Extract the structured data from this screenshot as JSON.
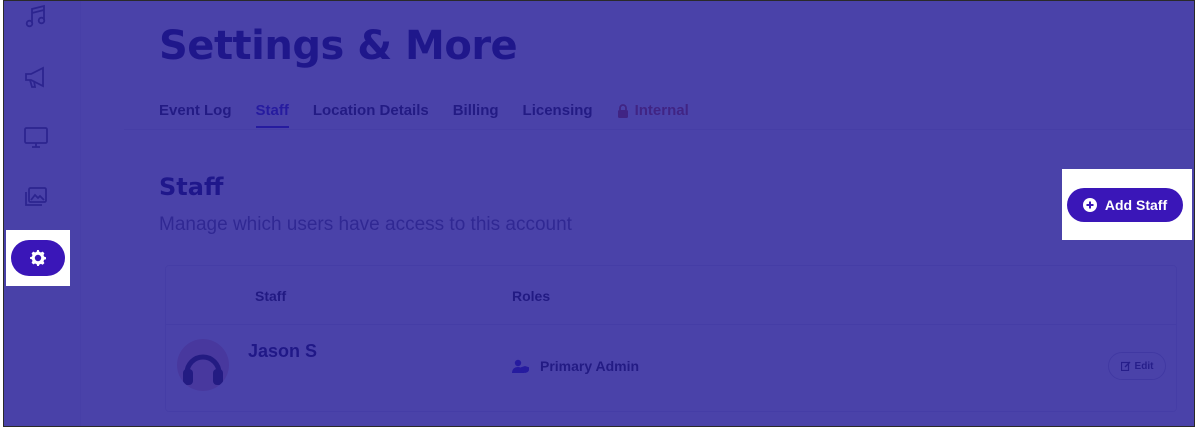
{
  "page": {
    "title": "Settings & More"
  },
  "tabs": [
    {
      "label": "Event Log"
    },
    {
      "label": "Staff"
    },
    {
      "label": "Location Details"
    },
    {
      "label": "Billing"
    },
    {
      "label": "Licensing"
    },
    {
      "label": "Internal"
    }
  ],
  "section": {
    "title": "Staff",
    "subtitle": "Manage which users have access to this account"
  },
  "actions": {
    "add_staff_label": "Add Staff"
  },
  "table": {
    "headers": {
      "staff": "Staff",
      "roles": "Roles"
    },
    "rows": [
      {
        "name": "Jason S",
        "role": "Primary Admin",
        "edit_label": "Edit"
      }
    ]
  },
  "sidebar": {
    "icons": [
      "music-icon",
      "megaphone-icon",
      "monitor-icon",
      "images-icon",
      "gear-icon"
    ]
  },
  "colors": {
    "overlay": "#2218a0",
    "accent": "#3a16b8",
    "title": "#15115a",
    "internal": "#c85a36"
  }
}
